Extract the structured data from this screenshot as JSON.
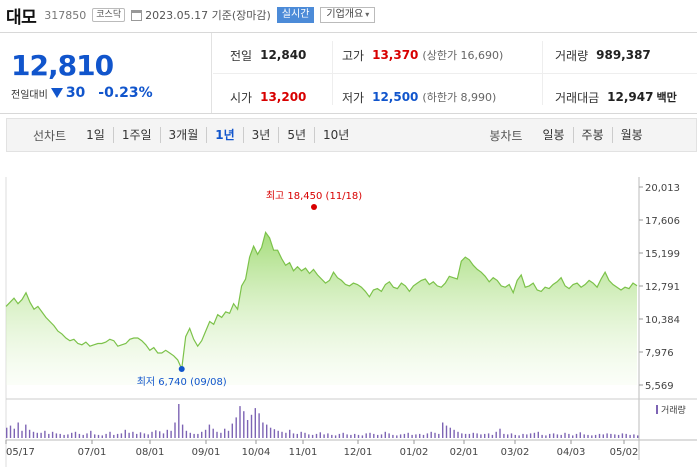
{
  "header": {
    "stock_name": "대모",
    "stock_code": "317850",
    "market_badge": "코스닥",
    "date_text": "2023.05.17 기준(장마감)",
    "live_badge": "실시간",
    "info_button": "기업개요"
  },
  "summary": {
    "price": "12,810",
    "change_label": "전일대비",
    "change_value": "30",
    "change_pct": "-0.23%",
    "prev_close_label": "전일",
    "prev_close": "12,840",
    "high_label": "고가",
    "high": "13,370",
    "upper_limit": "(상한가 16,690)",
    "volume_label": "거래량",
    "volume": "989,387",
    "open_label": "시가",
    "open": "13,200",
    "low_label": "저가",
    "low": "12,500",
    "lower_limit": "(하한가 8,990)",
    "amount_label": "거래대금",
    "amount": "12,947",
    "amount_unit": "백만"
  },
  "toolbar": {
    "line_chart_label": "선차트",
    "periods": [
      "1일",
      "1주일",
      "3개월",
      "1년",
      "3년",
      "5년",
      "10년"
    ],
    "active_period": "1년",
    "candle_label": "봉차트",
    "candle_periods": [
      "일봉",
      "주봉",
      "월봉"
    ]
  },
  "colors": {
    "accent_blue": "#1155cc",
    "up_red": "#d80000",
    "line_green": "#7cc24a"
  },
  "chart_data": {
    "type": "area",
    "y_ticks": [
      "20,013",
      "17,606",
      "15,199",
      "12,791",
      "10,384",
      "7,976",
      "5,569"
    ],
    "ylim": [
      5569,
      20013
    ],
    "x_ticks": [
      "05/17",
      "07/01",
      "08/01",
      "09/01",
      "10/04",
      "11/01",
      "12/01",
      "01/02",
      "02/01",
      "03/02",
      "04/03",
      "05/02"
    ],
    "max_annotation": "최고 18,450 (11/18)",
    "min_annotation": "최저 6,740 (09/08)",
    "volume_legend": "거래량",
    "series": [
      {
        "values": [
          11300,
          11600,
          11900,
          11500,
          11800,
          12300,
          11600,
          11100,
          11300,
          10900,
          10500,
          10200,
          9900,
          9500,
          9300,
          9000,
          8800,
          8900,
          8600,
          8500,
          8700,
          8400,
          8500,
          8600,
          8600,
          8700,
          8900,
          8800,
          8400,
          8500,
          8600,
          8900,
          9000,
          9000,
          8800,
          8500,
          8100,
          8300,
          7900,
          7900,
          8100,
          7900,
          7700,
          7400,
          6740,
          9100,
          9700,
          8900,
          8400,
          8800,
          9500,
          10200,
          10000,
          10700,
          10500,
          10900,
          10800,
          11500,
          11100,
          12800,
          13300,
          14900,
          15700,
          15100,
          15600,
          16700,
          16300,
          15400,
          15400,
          14800,
          14300,
          14500,
          13900,
          14200,
          13900,
          14100,
          13700,
          14000,
          13600,
          13300,
          13000,
          13200,
          13800,
          13400,
          13200,
          12900,
          12800,
          13000,
          12900,
          12700,
          12400,
          12000,
          12500,
          12600,
          12400,
          12900,
          13100,
          12700,
          12600,
          13000,
          12800,
          12400,
          12800,
          13000,
          13200,
          13300,
          12900,
          13100,
          12800,
          12700,
          13000,
          13500,
          13400,
          13300,
          14600,
          14900,
          14700,
          14300,
          14000,
          13800,
          13500,
          13100,
          13400,
          13200,
          12800,
          12700,
          12900,
          12300,
          13200,
          13600,
          12700,
          12800,
          13000,
          12500,
          12400,
          12700,
          12600,
          12900,
          13100,
          13400,
          12800,
          12600,
          12900,
          13000,
          12700,
          12900,
          13200,
          13000,
          12700,
          13300,
          13800,
          13200,
          12900,
          12700,
          12500,
          12700,
          12600,
          13000,
          12810
        ]
      }
    ],
    "volume": [
      20,
      24,
      18,
      30,
      14,
      26,
      16,
      12,
      10,
      10,
      14,
      8,
      12,
      9,
      8,
      6,
      7,
      10,
      12,
      8,
      6,
      9,
      14,
      7,
      6,
      5,
      8,
      12,
      6,
      8,
      9,
      16,
      10,
      12,
      8,
      11,
      9,
      7,
      12,
      15,
      13,
      9,
      16,
      14,
      30,
      66,
      26,
      14,
      10,
      8,
      8,
      12,
      16,
      26,
      18,
      12,
      10,
      18,
      14,
      28,
      40,
      62,
      52,
      35,
      45,
      58,
      48,
      30,
      26,
      20,
      17,
      14,
      12,
      10,
      16,
      9,
      8,
      12,
      10,
      7,
      6,
      8,
      11,
      7,
      9,
      6,
      5,
      8,
      10,
      7,
      6,
      8,
      6,
      5,
      9,
      10,
      8,
      6,
      7,
      12,
      9,
      6,
      5,
      7,
      8,
      10,
      6,
      7,
      8,
      6,
      9,
      12,
      10,
      8,
      30,
      24,
      20,
      16,
      12,
      9,
      8,
      8,
      10,
      9,
      7,
      8,
      9,
      6,
      12,
      18,
      8,
      7,
      9,
      6,
      5,
      8,
      7,
      9,
      10,
      12,
      6,
      5,
      8,
      9,
      7,
      6,
      10,
      8,
      5,
      8,
      11,
      7,
      6,
      5,
      6,
      8,
      7,
      9,
      8,
      7,
      6,
      9,
      8,
      6,
      7,
      5
    ]
  }
}
